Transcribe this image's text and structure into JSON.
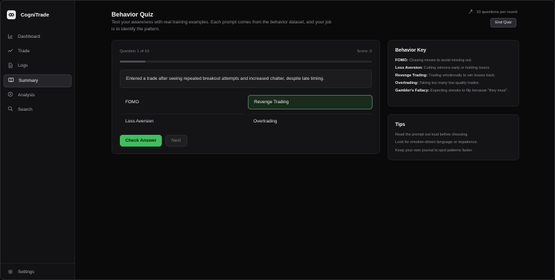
{
  "app": {
    "name": "CogniTrade"
  },
  "sidebar": {
    "items": [
      {
        "label": "Dashboard",
        "icon": "chart-icon",
        "active": false
      },
      {
        "label": "Trade",
        "icon": "trend-icon",
        "active": false
      },
      {
        "label": "Logs",
        "icon": "file-icon",
        "active": false
      },
      {
        "label": "Summary",
        "icon": "book-icon",
        "active": true
      },
      {
        "label": "Analysis",
        "icon": "compass-icon",
        "active": false
      },
      {
        "label": "Search",
        "icon": "search-icon",
        "active": false
      }
    ],
    "footer": {
      "label": "Settings",
      "icon": "gear-icon"
    }
  },
  "header": {
    "title": "Behavior Quiz",
    "subtitle": "Test your awareness with real training examples. Each prompt comes from the behavior dataset, and your job is to identify the pattern.",
    "round_info": "10 questions per round",
    "end_label": "End Quiz"
  },
  "quiz": {
    "counter": "Question 1 of 10",
    "score": "Score: 0",
    "progress": 0.1,
    "prompt": "Entered a trade after seeing repeated breakout attempts and increased chatter, despite late timing.",
    "options": [
      {
        "label": "FOMO",
        "selected": false
      },
      {
        "label": "Revenge Trading",
        "selected": true
      },
      {
        "label": "Loss Aversion",
        "selected": false
      },
      {
        "label": "Overtrading",
        "selected": false
      }
    ],
    "check_label": "Check Answer",
    "next_label": "Next"
  },
  "behavior_key": {
    "title": "Behavior Key",
    "items": [
      {
        "term": "FOMO:",
        "desc": "Chasing moves to avoid missing out."
      },
      {
        "term": "Loss Aversion:",
        "desc": "Cutting winners early or holding losers."
      },
      {
        "term": "Revenge Trading:",
        "desc": "Trading emotionally to win losses back."
      },
      {
        "term": "Overtrading:",
        "desc": "Taking too many low-quality trades."
      },
      {
        "term": "Gambler's Fallacy:",
        "desc": "Expecting streaks to flip because \"they must\"."
      }
    ]
  },
  "tips": {
    "title": "Tips",
    "items": [
      "Read the prompt out loud before choosing.",
      "Look for emotion-driven language or impatience.",
      "Keep your own journal to spot patterns faster."
    ]
  },
  "colors": {
    "accent": "#3fbf5f",
    "selected_border": "#4b7a52",
    "background": "#0a0a0b",
    "card": "#141416"
  }
}
